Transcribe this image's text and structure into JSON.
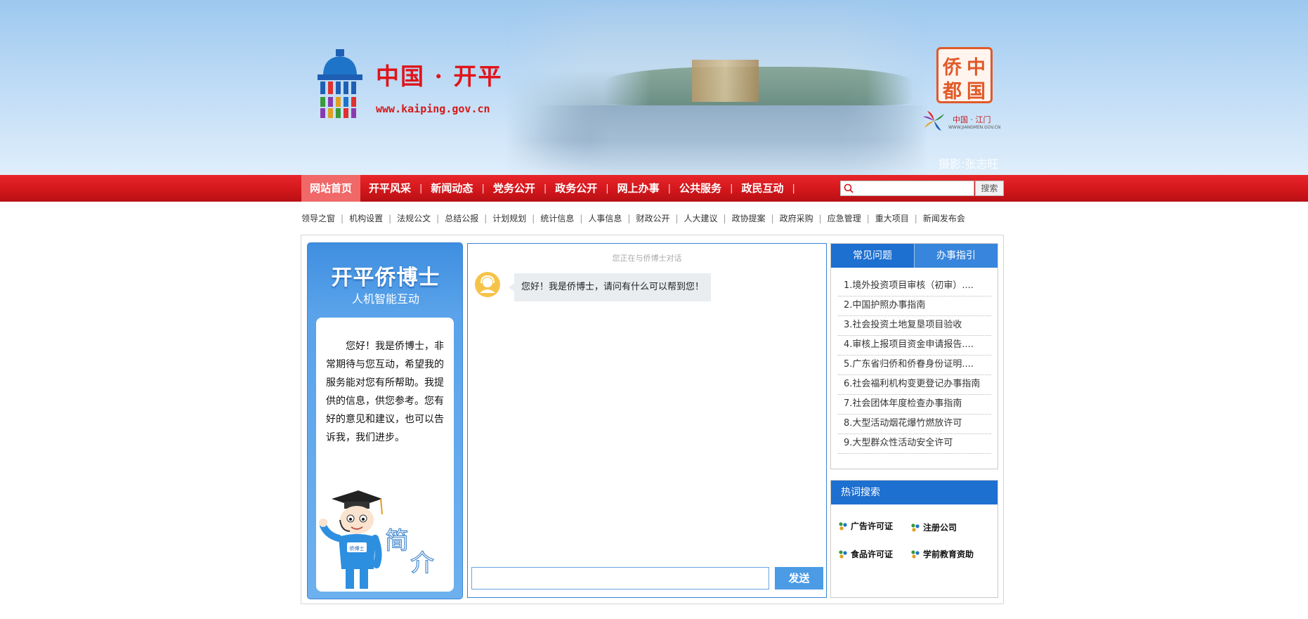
{
  "header": {
    "site_name": "中国 · 开平",
    "site_url": "www.kaiping.gov.cn",
    "qiaoxiang_logo": [
      "侨",
      "中",
      "都",
      "国"
    ],
    "jiangmen_text": "中国 · 江门",
    "jiangmen_url": "WWW.JIANGMEN.GOV.CN",
    "photo_credit": "摄影:张志旺"
  },
  "nav": {
    "items": [
      "网站首页",
      "开平风采",
      "新闻动态",
      "党务公开",
      "政务公开",
      "网上办事",
      "公共服务",
      "政民互动"
    ],
    "active_index": 0,
    "search_placeholder": "",
    "search_button": "搜索"
  },
  "subnav": {
    "items": [
      "领导之窗",
      "机构设置",
      "法规公文",
      "总结公报",
      "计划规划",
      "统计信息",
      "人事信息",
      "财政公开",
      "人大建议",
      "政协提案",
      "政府采购",
      "应急管理",
      "重大项目",
      "新闻发布会"
    ]
  },
  "intro": {
    "title": "开平侨博士",
    "subtitle": "人机智能互动",
    "text": "您好！我是侨博士，非常期待与您互动，希望我的服务能对您有所帮助。我提供的信息，供您参考。您有好的意见和建议，也可以告诉我，我们进步。",
    "badge": "侨博士",
    "jianjie": [
      "简",
      "介"
    ]
  },
  "chat": {
    "hint": "您正在与侨博士对话",
    "greeting": "您好！我是侨博士，请问有什么可以帮到您！",
    "input_value": "",
    "send_label": "发送"
  },
  "faq": {
    "tabs": [
      "常见问题",
      "办事指引"
    ],
    "items": [
      "1.境外投资项目审核（初审）....",
      "2.中国护照办事指南",
      "3.社会投资土地复垦项目验收",
      "4.审核上报项目资金申请报告....",
      "5.广东省归侨和侨眷身份证明....",
      "6.社会福利机构变更登记办事指南",
      "7.社会团体年度检查办事指南",
      "8.大型活动烟花爆竹燃放许可",
      "9.大型群众性活动安全许可"
    ]
  },
  "hot": {
    "title": "热词搜索",
    "words": [
      "广告许可证",
      "注册公司",
      "食品许可证",
      "学前教育资助"
    ]
  },
  "colors": {
    "nav_red": "#d0161b",
    "accent_blue": "#1d6fd0",
    "site_red": "#e0141a"
  }
}
